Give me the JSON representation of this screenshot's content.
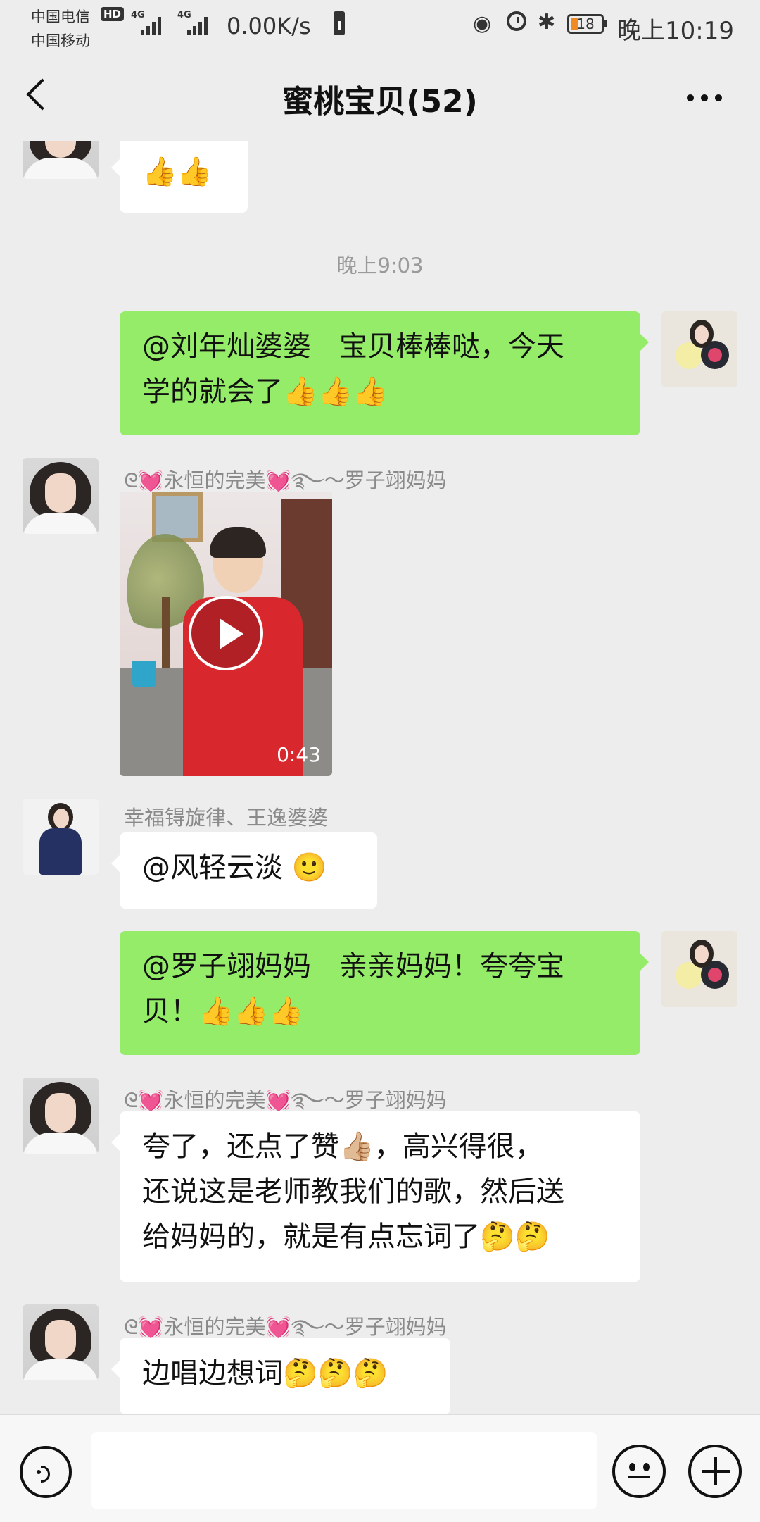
{
  "status_bar": {
    "carrier1": "中国电信",
    "hd_badge": "HD",
    "carrier2": "中国移动",
    "network1": "4G",
    "network2": "4G",
    "net_speed": "0.00K/s",
    "battery_level": "18",
    "time": "晚上10:19"
  },
  "nav": {
    "title": "蜜桃宝贝(52)"
  },
  "messages": {
    "m0_text": "👍👍",
    "timestamp": "晚上9:03",
    "m1_line1": "@刘年灿婆婆　宝贝棒棒哒，今天",
    "m1_line2": "学的就会了👍👍👍",
    "m2_sender": "ᘓ💓永恒的完美💓࿐〜罗子翊妈妈",
    "m2_video_duration": "0:43",
    "m3_sender": "幸福锝旋律、王逸婆婆",
    "m3_text": "@风轻云淡 🙂",
    "m4_line1": "@罗子翊妈妈　亲亲妈妈！夸夸宝",
    "m4_line2": "贝！👍👍👍",
    "m5_sender": "ᘓ💓永恒的完美💓࿐〜罗子翊妈妈",
    "m5_line1": "夸了，还点了赞👍🏼，高兴得很，",
    "m5_line2": "还说这是老师教我们的歌，然后送",
    "m5_line3": "给妈妈的，就是有点忘词了🤔🤔",
    "m6_sender": "ᘓ💓永恒的完美💓࿐〜罗子翊妈妈",
    "m6_text": "边唱边想词🤔🤔🤔"
  },
  "input": {
    "value": ""
  }
}
